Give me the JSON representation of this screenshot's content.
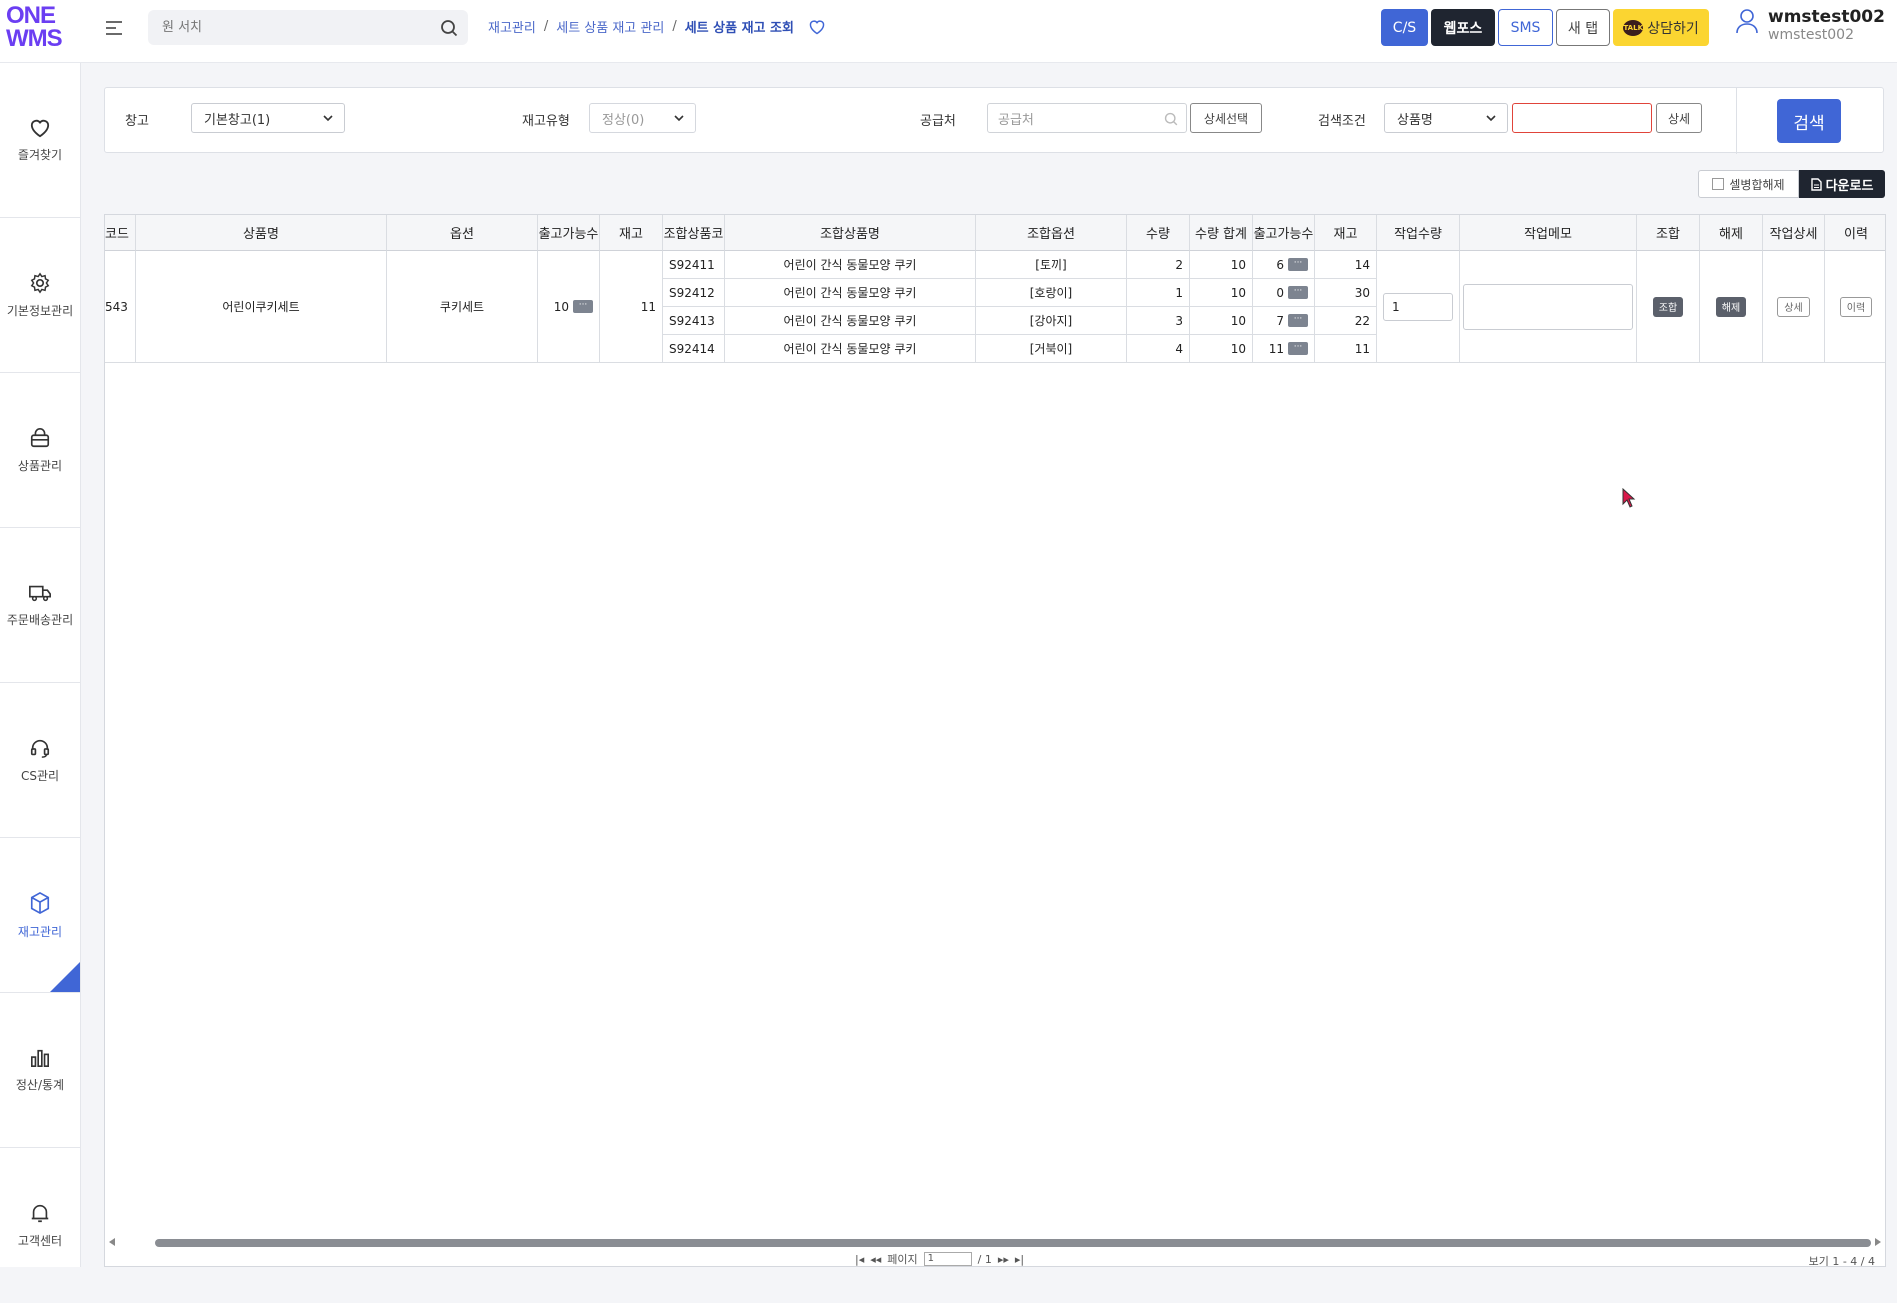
{
  "logo": {
    "line1": "ONE",
    "line2": "WMS",
    "color": "#6b3ef2"
  },
  "search": {
    "placeholder": "원 서치"
  },
  "breadcrumb": [
    "재고관리",
    "세트 상품 재고 관리",
    "세트 상품 재고 조회"
  ],
  "top_buttons": {
    "cs": "C/S",
    "webpos": "웹포스",
    "sms": "SMS",
    "new_tab": "새 탭",
    "consult": "상담하기",
    "talk_icon": "TALK"
  },
  "user": {
    "name": "wmstest002",
    "id": "wmstest002"
  },
  "sidebar": [
    {
      "label": "즐겨찾기",
      "icon": "heart-icon"
    },
    {
      "label": "기본정보관리",
      "icon": "gear-icon"
    },
    {
      "label": "상품관리",
      "icon": "bag-icon"
    },
    {
      "label": "주문배송관리",
      "icon": "truck-icon"
    },
    {
      "label": "CS관리",
      "icon": "headset-icon"
    },
    {
      "label": "재고관리",
      "icon": "cube-icon",
      "active": true
    },
    {
      "label": "정산/통계",
      "icon": "bar-chart-icon"
    },
    {
      "label": "고객센터",
      "icon": "bell-icon"
    }
  ],
  "filters": {
    "warehouse_label": "창고",
    "warehouse_value": "기본창고(1)",
    "stock_type_label": "재고유형",
    "stock_type_value": "정상(0)",
    "supplier_label": "공급처",
    "supplier_placeholder": "공급처",
    "supplier_detail": "상세선택",
    "condition_label": "검색조건",
    "condition_value": "상품명",
    "condition_detail": "상세",
    "search_button": "검색"
  },
  "toolbar": {
    "merge_release": "셀병합해제",
    "download": "다운로드"
  },
  "grid": {
    "headers": [
      "코드",
      "상품명",
      "옵션",
      "출고가능수",
      "재고",
      "조합상품코",
      "조합상품명",
      "조합옵션",
      "수량",
      "수량 합계",
      "출고가능수",
      "재고",
      "작업수량",
      "작업메모",
      "조합",
      "해제",
      "작업상세",
      "이력"
    ],
    "set_row": {
      "code": "543",
      "name": "어린이쿠키세트",
      "option": "쿠키세트",
      "available": "10",
      "stock": "11",
      "work_qty": "1",
      "combine": "조합",
      "release": "해제",
      "detail": "상세",
      "history": "이력"
    },
    "components": [
      {
        "code": "S92411",
        "name": "어린이 간식 동물모양 쿠키",
        "option": "[토끼]",
        "qty": "2",
        "qty_total": "10",
        "available": "6",
        "stock": "14"
      },
      {
        "code": "S92412",
        "name": "어린이 간식 동물모양 쿠키",
        "option": "[호랑이]",
        "qty": "1",
        "qty_total": "10",
        "available": "0",
        "stock": "30"
      },
      {
        "code": "S92413",
        "name": "어린이 간식 동물모양 쿠키",
        "option": "[강아지]",
        "qty": "3",
        "qty_total": "10",
        "available": "7",
        "stock": "22"
      },
      {
        "code": "S92414",
        "name": "어린이 간식 동물모양 쿠키",
        "option": "[거북이]",
        "qty": "4",
        "qty_total": "10",
        "available": "11",
        "stock": "11"
      }
    ],
    "dots_label": "···"
  },
  "pager": {
    "label": "페이지",
    "page": "1",
    "total": "/ 1",
    "view_info": "보기 1 - 4 / 4"
  },
  "colors": {
    "accent": "#4066d6",
    "dark": "#1f2530",
    "talk": "#fbd531"
  }
}
